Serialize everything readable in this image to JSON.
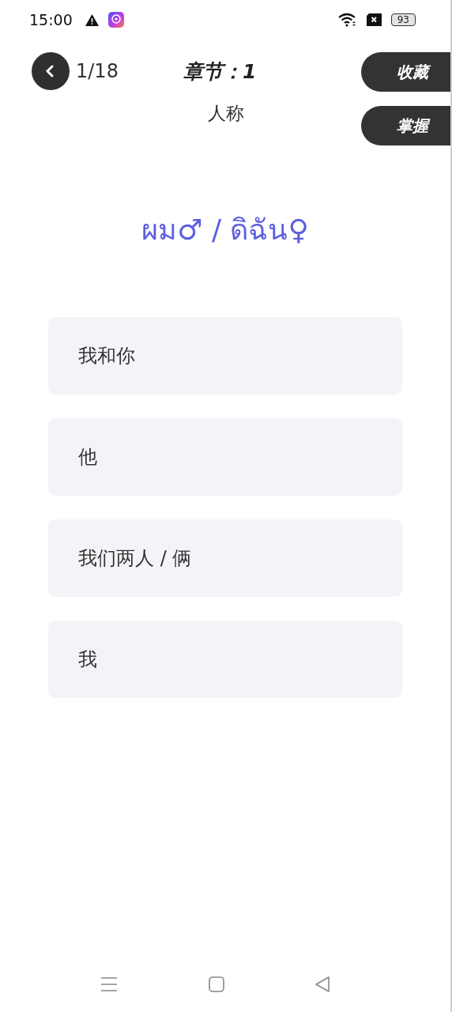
{
  "status_bar": {
    "time": "15:00",
    "battery": "93"
  },
  "header": {
    "counter": "1/18",
    "title": "章节：1",
    "subtitle": "人称"
  },
  "actions": [
    {
      "label": "收藏"
    },
    {
      "label": "掌握"
    }
  ],
  "word": "ผม♂ / ดิฉัน♀",
  "options": [
    {
      "text": "我和你"
    },
    {
      "text": "他"
    },
    {
      "text": "我们两人 / 俩"
    },
    {
      "text": "我"
    }
  ]
}
